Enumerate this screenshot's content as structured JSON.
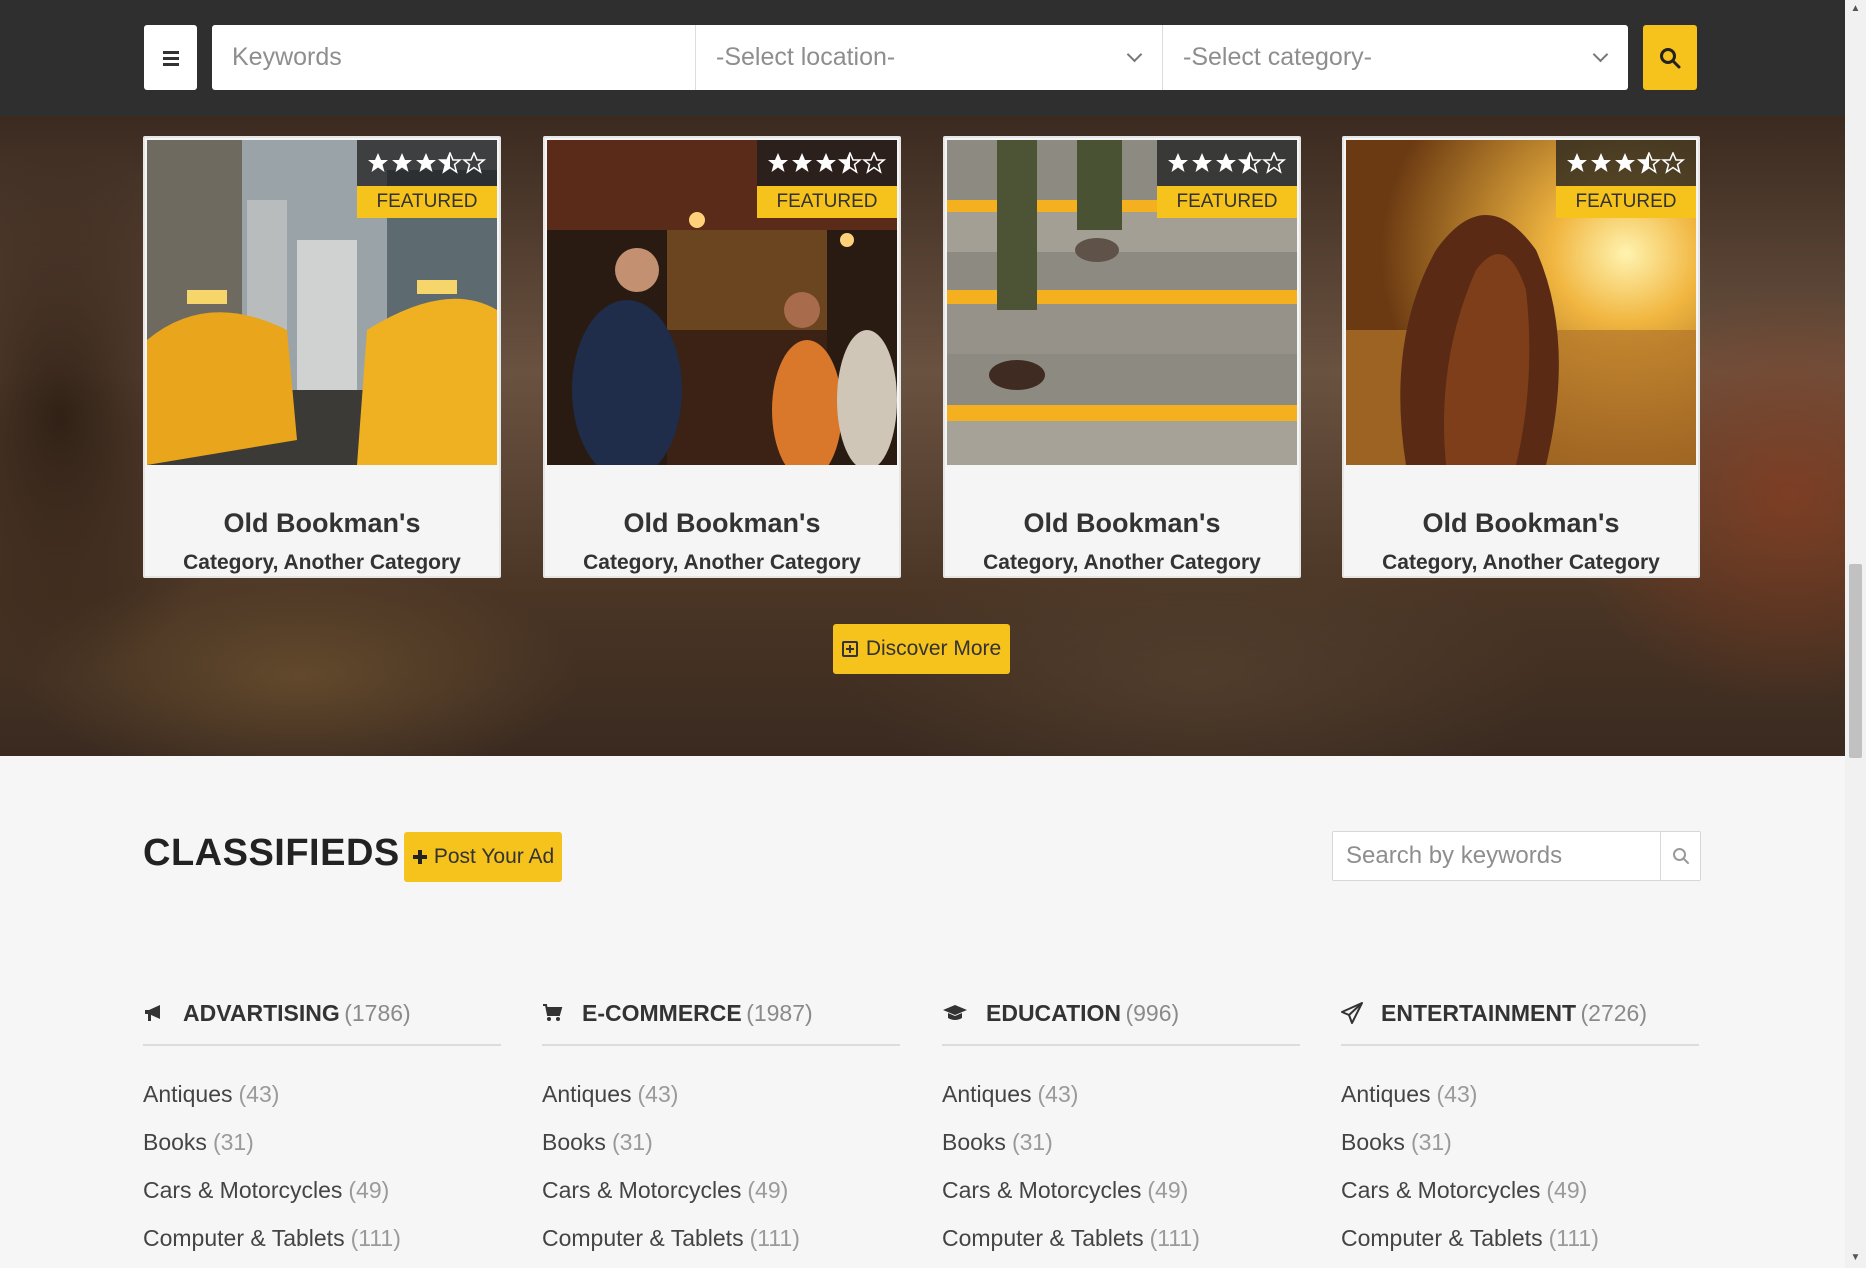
{
  "search_bar": {
    "keywords_placeholder": "Keywords",
    "location_placeholder": "-Select location-",
    "category_placeholder": "-Select category-"
  },
  "featured": {
    "cards": [
      {
        "title": "Old Bookman's",
        "categories": "Category, Another Category",
        "badge": "FEATURED",
        "rating": 3.5,
        "image": "city-taxis"
      },
      {
        "title": "Old Bookman's",
        "categories": "Category, Another Category",
        "badge": "FEATURED",
        "rating": 3.5,
        "image": "bar-interior"
      },
      {
        "title": "Old Bookman's",
        "categories": "Category, Another Category",
        "badge": "FEATURED",
        "rating": 3.5,
        "image": "stairs-steps"
      },
      {
        "title": "Old Bookman's",
        "categories": "Category, Another Category",
        "badge": "FEATURED",
        "rating": 3.5,
        "image": "girl-sunset-field"
      }
    ],
    "discover_label": "Discover More"
  },
  "classifieds": {
    "title": "CLASSIFIEDS",
    "post_label": "Post Your Ad",
    "search_placeholder": "Search by keywords",
    "columns": [
      {
        "icon": "bullhorn-icon",
        "name": "ADVARTISING",
        "count": "(1786)",
        "items": [
          {
            "label": "Antiques",
            "count": "(43)"
          },
          {
            "label": "Books",
            "count": "(31)"
          },
          {
            "label": "Cars & Motorcycles",
            "count": "(49)"
          },
          {
            "label": "Computer & Tablets",
            "count": "(111)"
          }
        ]
      },
      {
        "icon": "cart-icon",
        "name": "E-COMMERCE",
        "count": "(1987)",
        "items": [
          {
            "label": "Antiques",
            "count": "(43)"
          },
          {
            "label": "Books",
            "count": "(31)"
          },
          {
            "label": "Cars & Motorcycles",
            "count": "(49)"
          },
          {
            "label": "Computer & Tablets",
            "count": "(111)"
          }
        ]
      },
      {
        "icon": "graduation-cap-icon",
        "name": "EDUCATION",
        "count": "(996)",
        "items": [
          {
            "label": "Antiques",
            "count": "(43)"
          },
          {
            "label": "Books",
            "count": "(31)"
          },
          {
            "label": "Cars & Motorcycles",
            "count": "(49)"
          },
          {
            "label": "Computer & Tablets",
            "count": "(111)"
          }
        ]
      },
      {
        "icon": "paper-plane-icon",
        "name": "ENTERTAINMENT",
        "count": "(2726)",
        "items": [
          {
            "label": "Antiques",
            "count": "(43)"
          },
          {
            "label": "Books",
            "count": "(31)"
          },
          {
            "label": "Cars & Motorcycles",
            "count": "(49)"
          },
          {
            "label": "Computer & Tablets",
            "count": "(111)"
          }
        ]
      }
    ]
  },
  "colors": {
    "accent": "#f6c21c",
    "topbar": "#2f2f2f"
  }
}
